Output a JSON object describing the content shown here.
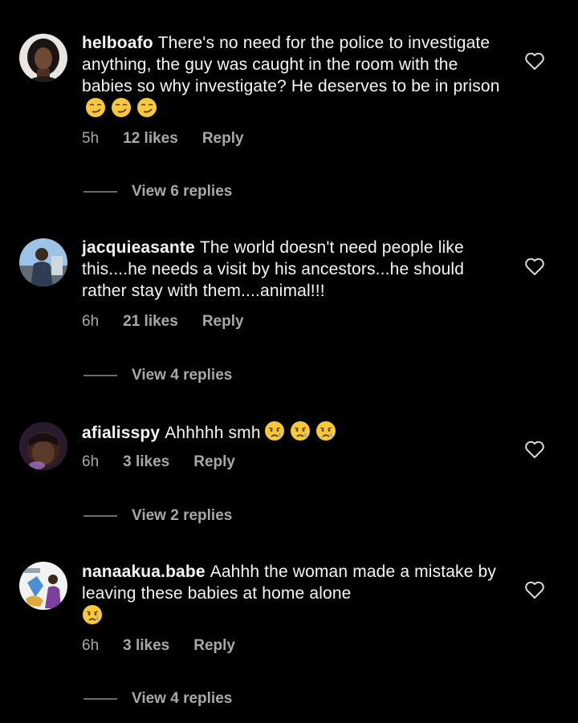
{
  "comments": [
    {
      "username": "helboafo",
      "text": "There's no need for the police to investigate anything, the guy was caught in the room with the babies so why investigate? He deserves to be in prison",
      "emojis": [
        "smirking-face",
        "smirking-face",
        "smirking-face"
      ],
      "time": "5h",
      "likes": "12 likes",
      "reply": "Reply",
      "view_replies": "View 6 replies"
    },
    {
      "username": "jacquieasante",
      "text": "The world doesn't need people like this....he needs a visit by his ancestors...he should rather stay with them....animal!!!",
      "emojis": [],
      "time": "6h",
      "likes": "21 likes",
      "reply": "Reply",
      "view_replies": "View 4 replies"
    },
    {
      "username": "afialisspy",
      "text": "Ahhhhh smh",
      "emojis": [
        "crying-face",
        "crying-face",
        "crying-face"
      ],
      "time": "6h",
      "likes": "3 likes",
      "reply": "Reply",
      "view_replies": "View 2 replies"
    },
    {
      "username": "nanaakua.babe",
      "text": "Aahhh the woman made a mistake by leaving these babies at home alone",
      "emojis": [
        "crying-face"
      ],
      "time": "6h",
      "likes": "3 likes",
      "reply": "Reply",
      "view_replies": "View 4 replies"
    }
  ],
  "colors": {
    "background": "#000000",
    "primary_text": "#f5f5f5",
    "secondary_text": "#a8a8a8",
    "divider_line": "#6b6b6b",
    "emoji_yellow": "#f7c93a",
    "tear_blue": "#5aa9e6"
  }
}
